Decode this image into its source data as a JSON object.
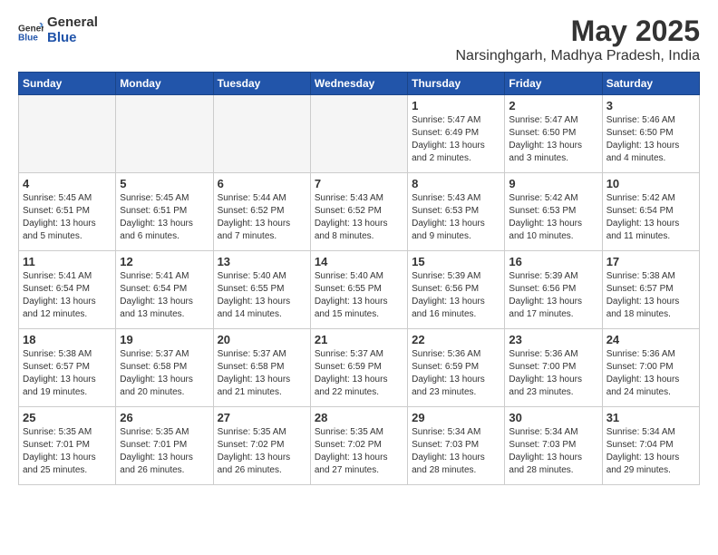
{
  "header": {
    "logo_general": "General",
    "logo_blue": "Blue",
    "title": "May 2025",
    "subtitle": "Narsinghgarh, Madhya Pradesh, India"
  },
  "weekdays": [
    "Sunday",
    "Monday",
    "Tuesday",
    "Wednesday",
    "Thursday",
    "Friday",
    "Saturday"
  ],
  "weeks": [
    [
      {
        "day": "",
        "empty": true
      },
      {
        "day": "",
        "empty": true
      },
      {
        "day": "",
        "empty": true
      },
      {
        "day": "",
        "empty": true
      },
      {
        "day": "1",
        "sunrise": "Sunrise: 5:47 AM",
        "sunset": "Sunset: 6:49 PM",
        "daylight": "Daylight: 13 hours and 2 minutes."
      },
      {
        "day": "2",
        "sunrise": "Sunrise: 5:47 AM",
        "sunset": "Sunset: 6:50 PM",
        "daylight": "Daylight: 13 hours and 3 minutes."
      },
      {
        "day": "3",
        "sunrise": "Sunrise: 5:46 AM",
        "sunset": "Sunset: 6:50 PM",
        "daylight": "Daylight: 13 hours and 4 minutes."
      }
    ],
    [
      {
        "day": "4",
        "sunrise": "Sunrise: 5:45 AM",
        "sunset": "Sunset: 6:51 PM",
        "daylight": "Daylight: 13 hours and 5 minutes."
      },
      {
        "day": "5",
        "sunrise": "Sunrise: 5:45 AM",
        "sunset": "Sunset: 6:51 PM",
        "daylight": "Daylight: 13 hours and 6 minutes."
      },
      {
        "day": "6",
        "sunrise": "Sunrise: 5:44 AM",
        "sunset": "Sunset: 6:52 PM",
        "daylight": "Daylight: 13 hours and 7 minutes."
      },
      {
        "day": "7",
        "sunrise": "Sunrise: 5:43 AM",
        "sunset": "Sunset: 6:52 PM",
        "daylight": "Daylight: 13 hours and 8 minutes."
      },
      {
        "day": "8",
        "sunrise": "Sunrise: 5:43 AM",
        "sunset": "Sunset: 6:53 PM",
        "daylight": "Daylight: 13 hours and 9 minutes."
      },
      {
        "day": "9",
        "sunrise": "Sunrise: 5:42 AM",
        "sunset": "Sunset: 6:53 PM",
        "daylight": "Daylight: 13 hours and 10 minutes."
      },
      {
        "day": "10",
        "sunrise": "Sunrise: 5:42 AM",
        "sunset": "Sunset: 6:54 PM",
        "daylight": "Daylight: 13 hours and 11 minutes."
      }
    ],
    [
      {
        "day": "11",
        "sunrise": "Sunrise: 5:41 AM",
        "sunset": "Sunset: 6:54 PM",
        "daylight": "Daylight: 13 hours and 12 minutes."
      },
      {
        "day": "12",
        "sunrise": "Sunrise: 5:41 AM",
        "sunset": "Sunset: 6:54 PM",
        "daylight": "Daylight: 13 hours and 13 minutes."
      },
      {
        "day": "13",
        "sunrise": "Sunrise: 5:40 AM",
        "sunset": "Sunset: 6:55 PM",
        "daylight": "Daylight: 13 hours and 14 minutes."
      },
      {
        "day": "14",
        "sunrise": "Sunrise: 5:40 AM",
        "sunset": "Sunset: 6:55 PM",
        "daylight": "Daylight: 13 hours and 15 minutes."
      },
      {
        "day": "15",
        "sunrise": "Sunrise: 5:39 AM",
        "sunset": "Sunset: 6:56 PM",
        "daylight": "Daylight: 13 hours and 16 minutes."
      },
      {
        "day": "16",
        "sunrise": "Sunrise: 5:39 AM",
        "sunset": "Sunset: 6:56 PM",
        "daylight": "Daylight: 13 hours and 17 minutes."
      },
      {
        "day": "17",
        "sunrise": "Sunrise: 5:38 AM",
        "sunset": "Sunset: 6:57 PM",
        "daylight": "Daylight: 13 hours and 18 minutes."
      }
    ],
    [
      {
        "day": "18",
        "sunrise": "Sunrise: 5:38 AM",
        "sunset": "Sunset: 6:57 PM",
        "daylight": "Daylight: 13 hours and 19 minutes."
      },
      {
        "day": "19",
        "sunrise": "Sunrise: 5:37 AM",
        "sunset": "Sunset: 6:58 PM",
        "daylight": "Daylight: 13 hours and 20 minutes."
      },
      {
        "day": "20",
        "sunrise": "Sunrise: 5:37 AM",
        "sunset": "Sunset: 6:58 PM",
        "daylight": "Daylight: 13 hours and 21 minutes."
      },
      {
        "day": "21",
        "sunrise": "Sunrise: 5:37 AM",
        "sunset": "Sunset: 6:59 PM",
        "daylight": "Daylight: 13 hours and 22 minutes."
      },
      {
        "day": "22",
        "sunrise": "Sunrise: 5:36 AM",
        "sunset": "Sunset: 6:59 PM",
        "daylight": "Daylight: 13 hours and 23 minutes."
      },
      {
        "day": "23",
        "sunrise": "Sunrise: 5:36 AM",
        "sunset": "Sunset: 7:00 PM",
        "daylight": "Daylight: 13 hours and 23 minutes."
      },
      {
        "day": "24",
        "sunrise": "Sunrise: 5:36 AM",
        "sunset": "Sunset: 7:00 PM",
        "daylight": "Daylight: 13 hours and 24 minutes."
      }
    ],
    [
      {
        "day": "25",
        "sunrise": "Sunrise: 5:35 AM",
        "sunset": "Sunset: 7:01 PM",
        "daylight": "Daylight: 13 hours and 25 minutes."
      },
      {
        "day": "26",
        "sunrise": "Sunrise: 5:35 AM",
        "sunset": "Sunset: 7:01 PM",
        "daylight": "Daylight: 13 hours and 26 minutes."
      },
      {
        "day": "27",
        "sunrise": "Sunrise: 5:35 AM",
        "sunset": "Sunset: 7:02 PM",
        "daylight": "Daylight: 13 hours and 26 minutes."
      },
      {
        "day": "28",
        "sunrise": "Sunrise: 5:35 AM",
        "sunset": "Sunset: 7:02 PM",
        "daylight": "Daylight: 13 hours and 27 minutes."
      },
      {
        "day": "29",
        "sunrise": "Sunrise: 5:34 AM",
        "sunset": "Sunset: 7:03 PM",
        "daylight": "Daylight: 13 hours and 28 minutes."
      },
      {
        "day": "30",
        "sunrise": "Sunrise: 5:34 AM",
        "sunset": "Sunset: 7:03 PM",
        "daylight": "Daylight: 13 hours and 28 minutes."
      },
      {
        "day": "31",
        "sunrise": "Sunrise: 5:34 AM",
        "sunset": "Sunset: 7:04 PM",
        "daylight": "Daylight: 13 hours and 29 minutes."
      }
    ]
  ]
}
